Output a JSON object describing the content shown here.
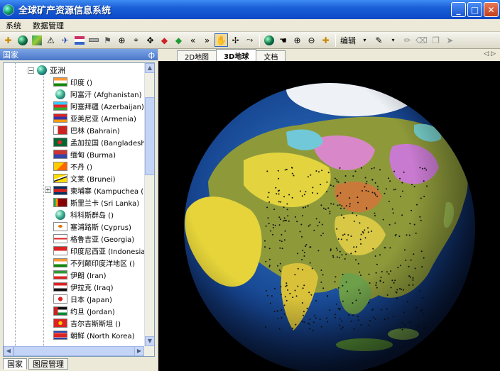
{
  "window": {
    "title": "全球矿产资源信息系统"
  },
  "menu": [
    "系统",
    "数据管理"
  ],
  "toolbar": {
    "edit_label": "编辑"
  },
  "left_panel": {
    "header": "国家",
    "pin": "ф",
    "region": "亚洲",
    "countries": [
      {
        "name": "印度 ()",
        "flag": "india"
      },
      {
        "name": "阿富汗 (Afghanistan)",
        "flag": "globe"
      },
      {
        "name": "阿塞拜疆 (Azerbaijan)",
        "flag": "azerbaijan"
      },
      {
        "name": "亚美尼亚 (Armenia)",
        "flag": "armenia"
      },
      {
        "name": "巴林 (Bahrain)",
        "flag": "bahrain"
      },
      {
        "name": "孟加拉国 (Bangladesh)",
        "flag": "bangladesh"
      },
      {
        "name": "缅甸 (Burma)",
        "flag": "burma"
      },
      {
        "name": "不丹 ()",
        "flag": "bhutan"
      },
      {
        "name": "文莱 (Brunei)",
        "flag": "brunei"
      },
      {
        "name": "柬埔寨 (Kampuchea (C",
        "flag": "cambodia"
      },
      {
        "name": "斯里兰卡 (Sri Lanka)",
        "flag": "srilanka"
      },
      {
        "name": "科科斯群岛 ()",
        "flag": "globe"
      },
      {
        "name": "塞浦路斯 (Cyprus)",
        "flag": "cyprus"
      },
      {
        "name": "格鲁吉亚 (Georgia)",
        "flag": "georgia"
      },
      {
        "name": "印度尼西亚 (Indonesia",
        "flag": "indonesia"
      },
      {
        "name": "不列颠印度洋地区 ()",
        "flag": "india"
      },
      {
        "name": "伊朗 (Iran)",
        "flag": "iran"
      },
      {
        "name": "伊拉克 (Iraq)",
        "flag": "iraq"
      },
      {
        "name": "日本 (Japan)",
        "flag": "japan"
      },
      {
        "name": "约旦 (Jordan)",
        "flag": "jordan"
      },
      {
        "name": "吉尔吉斯斯坦 ()",
        "flag": "kyrgyz"
      },
      {
        "name": "朝鲜 (North Korea)",
        "flag": "northkorea"
      }
    ],
    "bottom_tabs": [
      "国家",
      "图层管理"
    ]
  },
  "right_pane": {
    "tabs": [
      "2D地图",
      "3D地球",
      "文档"
    ],
    "active_tab": "3D地球",
    "nav": "◁ ▷"
  }
}
